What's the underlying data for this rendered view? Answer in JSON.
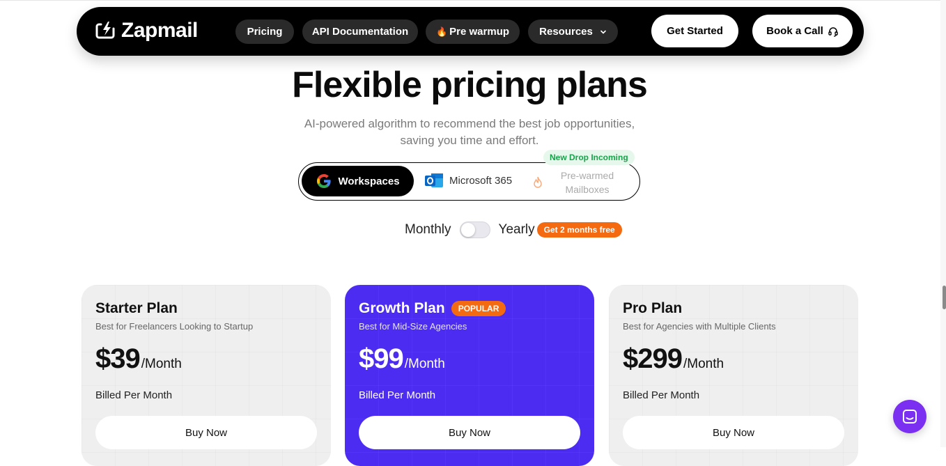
{
  "nav": {
    "brand": "Zapmail",
    "items": [
      {
        "label": "Pricing"
      },
      {
        "label": "API Documentation"
      },
      {
        "label": "Pre warmup",
        "emoji": "🔥"
      },
      {
        "label": "Resources"
      }
    ],
    "get_started": "Get Started",
    "book_call": "Book a Call"
  },
  "hero": {
    "title": "Flexible pricing plans",
    "subtitle_line1": "AI-powered algorithm to recommend the best job opportunities,",
    "subtitle_line2": "saving you time and effort."
  },
  "providers": {
    "active": "Workspaces",
    "microsoft": "Microsoft 365",
    "prewarmed_line1": "Pre-warmed",
    "prewarmed_line2": "Mailboxes",
    "new_drop_badge": "New Drop Incoming"
  },
  "billing": {
    "monthly": "Monthly",
    "yearly": "Yearly",
    "yearly_enabled": false,
    "promo": "Get 2 months free"
  },
  "plans": [
    {
      "name": "Starter Plan",
      "desc": "Best for Freelancers Looking to Startup",
      "price": "$39",
      "unit": "/Month",
      "billed": "Billed Per Month",
      "cta": "Buy Now"
    },
    {
      "name": "Growth Plan",
      "badge": "POPULAR",
      "desc": "Best for Mid-Size Agencies",
      "price": "$99",
      "unit": "/Month",
      "billed": "Billed Per Month",
      "cta": "Buy Now"
    },
    {
      "name": "Pro Plan",
      "desc": "Best for Agencies with Multiple Clients",
      "price": "$299",
      "unit": "/Month",
      "billed": "Billed Per Month",
      "cta": "Buy Now"
    }
  ],
  "colors": {
    "featured": "#4b2cf0",
    "badge_orange": "#f36a10",
    "nav_bg": "#000000",
    "chat": "#7b2ff0"
  },
  "icons": {
    "logo": "lightning-icon",
    "resources_chevron": "chevron-down-icon",
    "book_call": "headset-icon",
    "workspaces": "google-icon",
    "microsoft": "outlook-icon",
    "prewarmed": "flame-icon",
    "chat": "chat-icon"
  }
}
